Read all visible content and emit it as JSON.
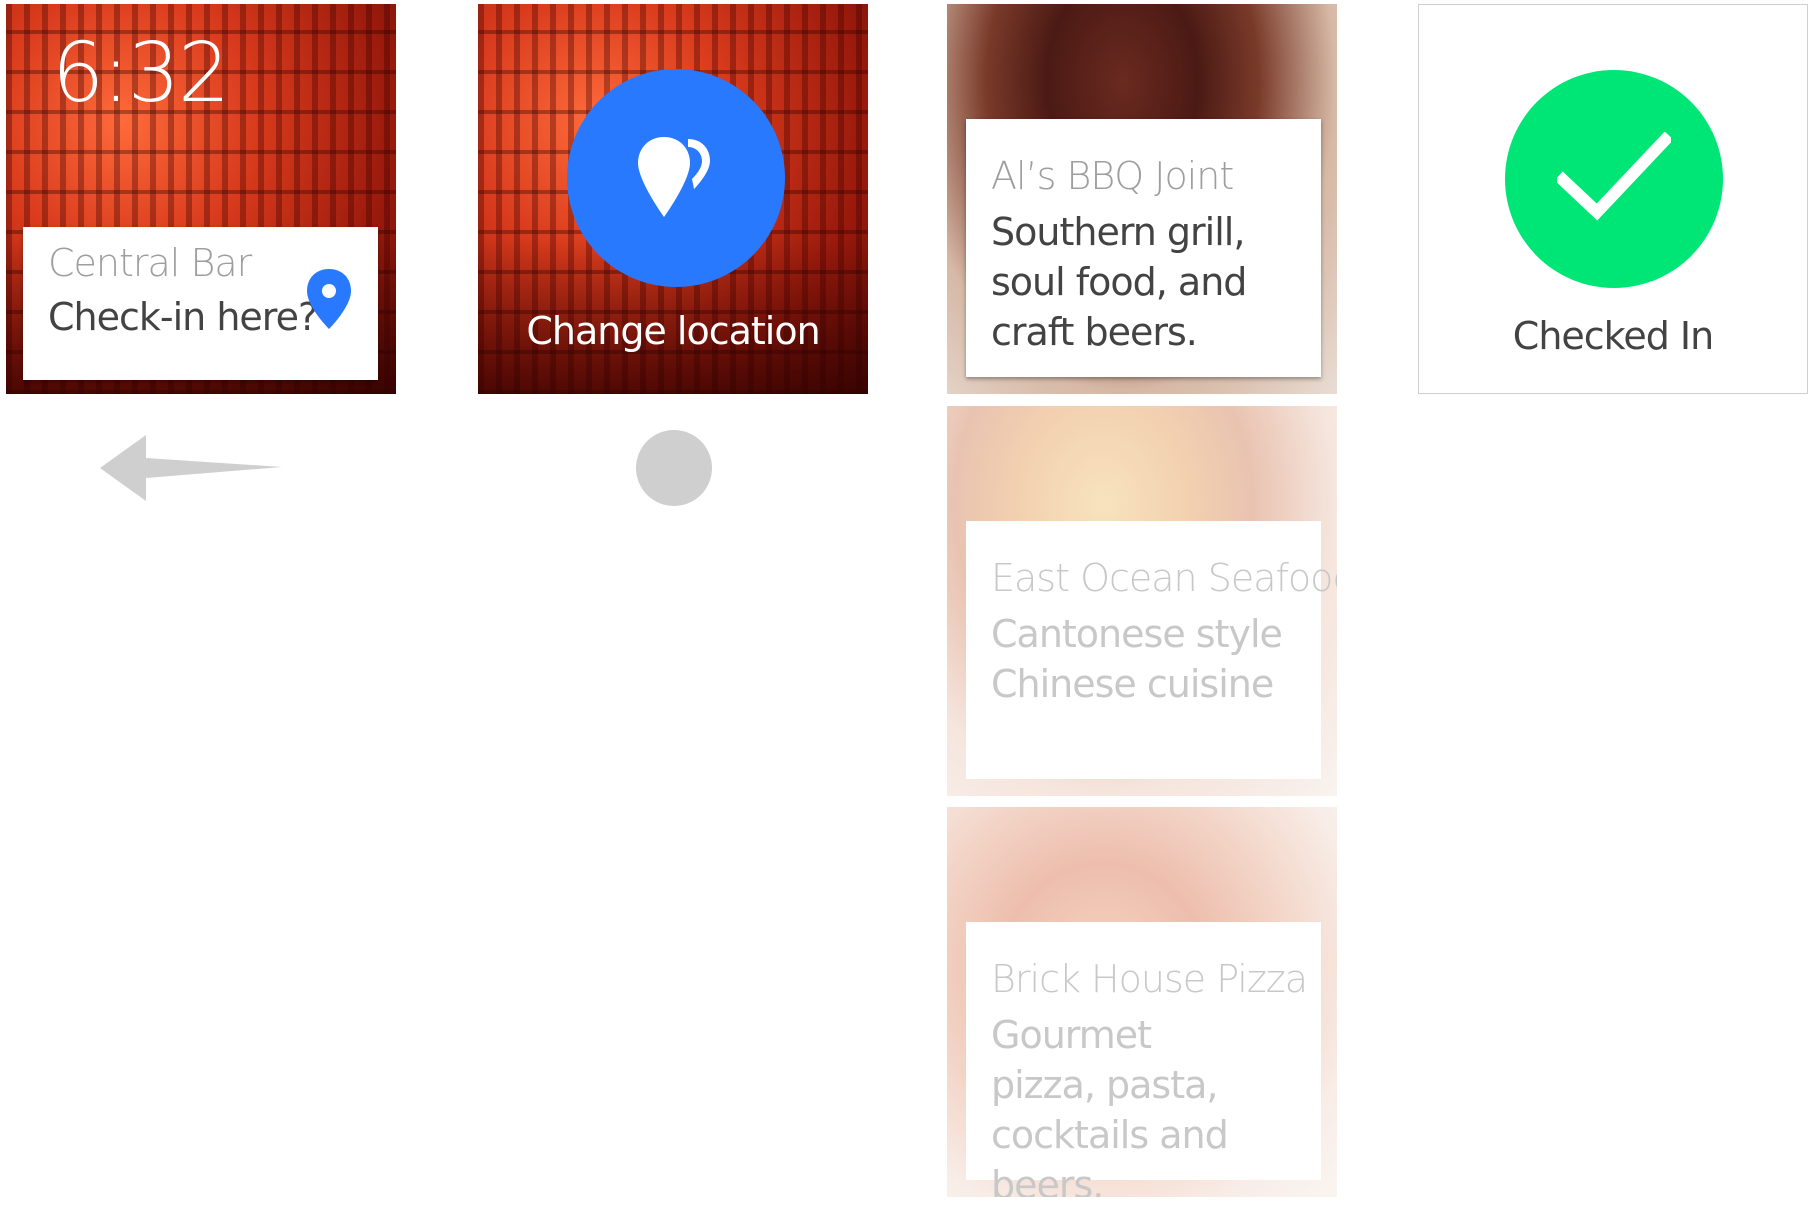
{
  "screen1": {
    "time": "6:32",
    "card_title": "Central Bar",
    "card_body": "Check-in here?",
    "icon": "location-pin-icon",
    "accent": "#2979ff"
  },
  "screen2": {
    "label": "Change location",
    "icon": "change-location-icon",
    "circle_color": "#2979ff"
  },
  "places": [
    {
      "title": "Al’s BBQ Joint",
      "body": "Southern grill, soul food, and craft beers."
    },
    {
      "title": "East Ocean Seafood",
      "body": "Cantonese style Chinese cuisine"
    },
    {
      "title": "Brick House Pizza",
      "body": "Gourmet pizza, pasta, cocktails and beers."
    }
  ],
  "screen4": {
    "label": "Checked In",
    "icon": "checkmark-icon",
    "circle_color": "#00e676"
  },
  "gestures": {
    "swipe": "swipe-left-arrow-icon",
    "tap": "tap-dot-icon"
  }
}
